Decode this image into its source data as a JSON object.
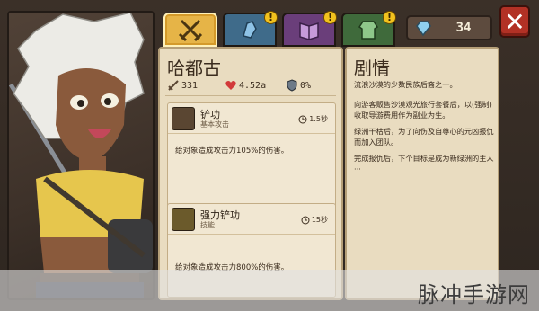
{
  "hero": {
    "name": "哈都古",
    "stats": {
      "attack": "331",
      "hp": "4.52a",
      "defense": "0%"
    }
  },
  "tabs": [
    {
      "name": "weapon",
      "icon": "crossed-swords-icon",
      "active": true,
      "alert": false
    },
    {
      "name": "crystal",
      "icon": "crystal-icon",
      "active": false,
      "alert": true
    },
    {
      "name": "book",
      "icon": "book-icon",
      "active": false,
      "alert": true
    },
    {
      "name": "armor",
      "icon": "armor-icon",
      "active": false,
      "alert": true
    }
  ],
  "alert_mark": "!",
  "currency": {
    "icon": "gem-icon",
    "value": "34"
  },
  "close_label": "✕",
  "skills": [
    {
      "name": "铲功",
      "type": "基本攻击",
      "cooldown": "1.5秒",
      "desc": "给对象造成攻击力105%的伤害。"
    },
    {
      "name": "强力铲功",
      "type": "技能",
      "cooldown": "15秒",
      "desc": "给对象造成攻击力800%的伤害。"
    }
  ],
  "story": {
    "title": "剧情",
    "paragraphs": [
      "流浪沙漠的少数民族后裔之一。",
      "向游客贩售沙漠观光旅行套餐后，以(强制)收取导游费用作为副业为生。",
      "绿洲干枯后，为了向伤及自尊心的元凶报仇而加入团队。",
      "完成报仇后，下个目标是成为新绿洲的主人···"
    ]
  },
  "watermark": "脉冲手游网",
  "colors": {
    "active_tab": "#e6b447",
    "close": "#b23125",
    "parchment": "#e9dcc0",
    "alert": "#f2c21e"
  }
}
